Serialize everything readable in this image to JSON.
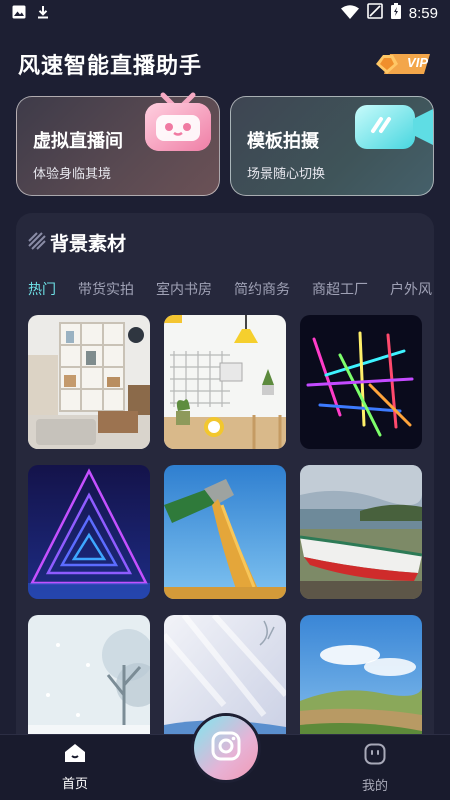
{
  "status_bar": {
    "time": "8:59",
    "left_icons": [
      "image-icon",
      "download-icon"
    ],
    "right_icons": [
      "wifi-icon",
      "no-signal-icon",
      "battery-icon"
    ]
  },
  "header": {
    "title": "风速智能直播助手",
    "vip_label": "VIP"
  },
  "features": [
    {
      "title": "虚拟直播间",
      "subtitle": "体验身临其境",
      "icon": "tv-robot-icon"
    },
    {
      "title": "模板拍摄",
      "subtitle": "场景随心切换",
      "icon": "video-camera-icon"
    }
  ],
  "materials": {
    "title": "背景素材",
    "tabs": [
      {
        "label": "热门",
        "active": true
      },
      {
        "label": "带货实拍",
        "active": false
      },
      {
        "label": "室内书房",
        "active": false
      },
      {
        "label": "简约商务",
        "active": false
      },
      {
        "label": "商超工厂",
        "active": false
      },
      {
        "label": "户外风",
        "active": false
      }
    ],
    "items": [
      "bookshelf-room-image",
      "yellow-lamp-desk-image",
      "neon-lines-image",
      "neon-triangle-image",
      "grain-harvest-image",
      "boat-shore-image",
      "snow-tree-image",
      "snowy-landscape-image",
      "grassland-sky-image"
    ]
  },
  "bottom_nav": {
    "home_label": "首页",
    "mine_label": "我的"
  },
  "colors": {
    "background": "#1d1f33",
    "panel": "#26283c",
    "active_tab": "#6ee0e6",
    "vip_gold": "#f3a64a"
  }
}
